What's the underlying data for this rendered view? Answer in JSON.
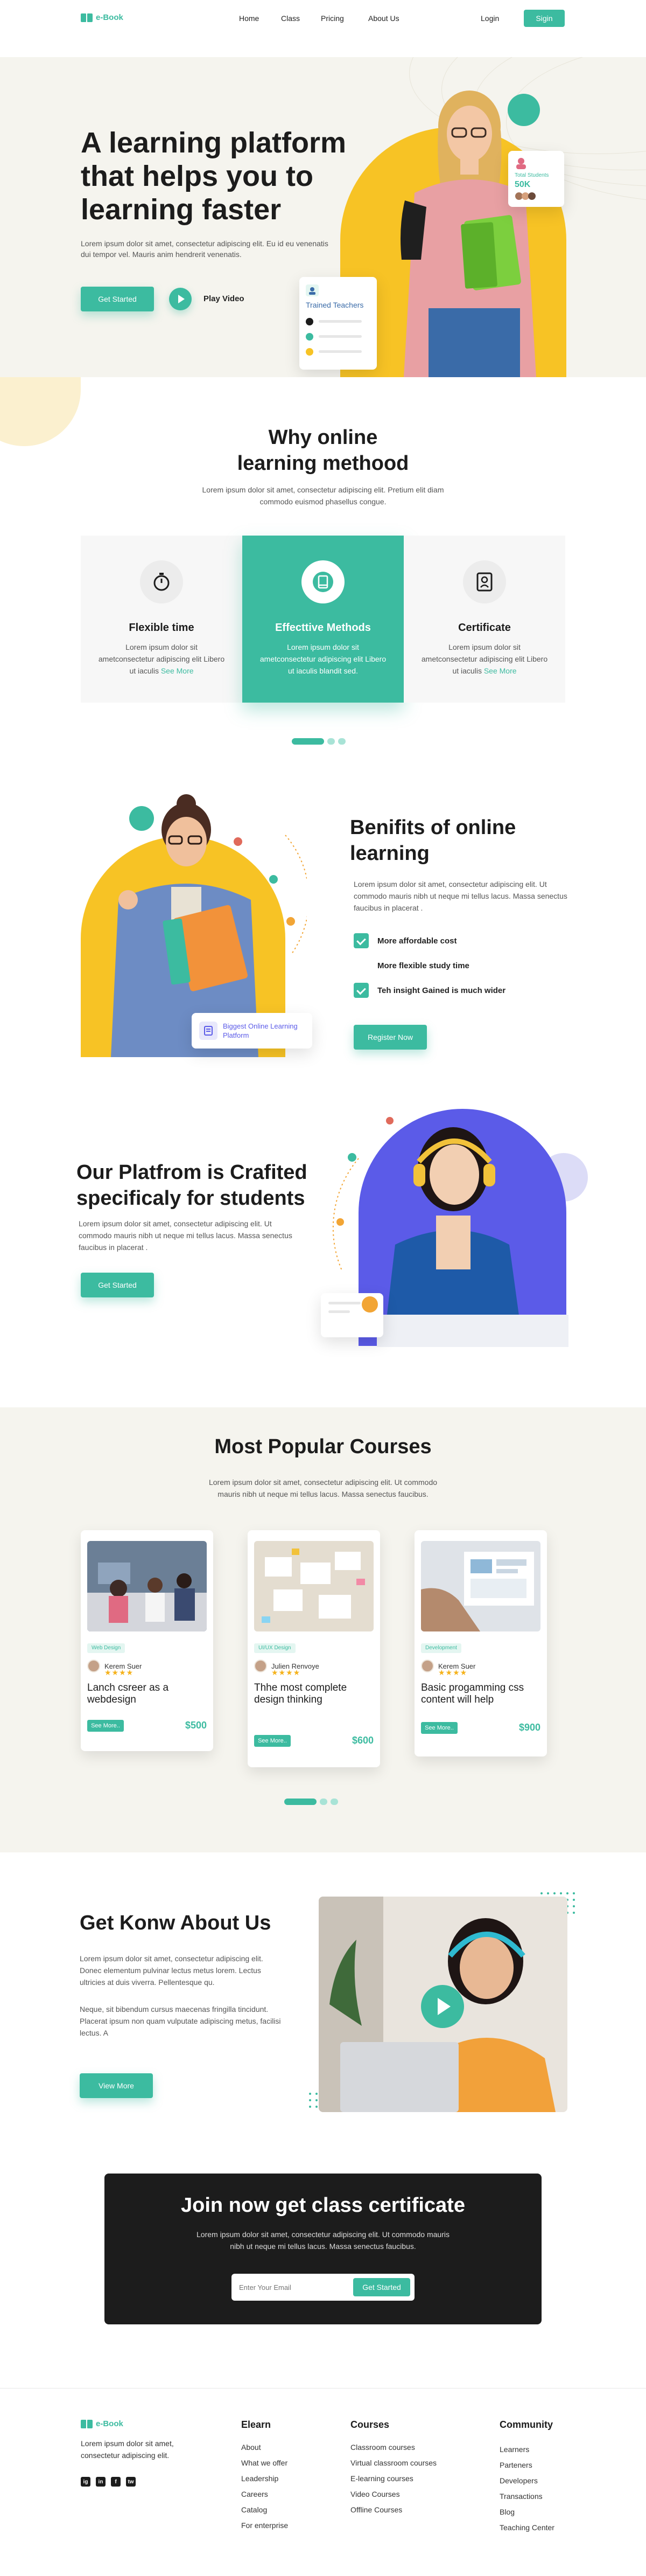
{
  "nav": {
    "brand": "e-Book",
    "links": [
      "Home",
      "Class",
      "Pricing",
      "About Us"
    ],
    "login": "Login",
    "signin": "Sigin"
  },
  "hero": {
    "title": "A learning platform that helps you to learning faster",
    "text": "Lorem ipsum dolor sit amet, consectetur adipiscing elit. Eu id eu venenatis dui tempor vel. Mauris anim hendrerit venenatis.",
    "cta": "Get Started",
    "play": "Play Video",
    "stat_label": "Total Students",
    "stat_value": "50K",
    "trained_label": "Trained Teachers"
  },
  "why": {
    "title": "Why online learning methood",
    "text": "Lorem ipsum dolor sit amet, consectetur adipiscing elit. Pretium elit diam commodo euismod phasellus congue.",
    "features": [
      {
        "title": "Flexible time",
        "text": "Lorem ipsum dolor sit ametconsectetur adipiscing elit Libero ut iaculis",
        "link": "See More"
      },
      {
        "title": "Effecttive Methods",
        "text": "Lorem ipsum dolor sit ametconsectetur adipiscing elit Libero ut iaculis blandit sed."
      },
      {
        "title": "Certificate",
        "text": "Lorem ipsum dolor sit ametconsectetur adipiscing elit Libero ut iaculis",
        "link": "See More"
      }
    ]
  },
  "benefits": {
    "title": "Benifits of online learning",
    "text": "Lorem ipsum dolor sit amet, consectetur adipiscing elit. Ut commodo mauris nibh ut neque mi tellus lacus. Massa senectus faucibus in placerat .",
    "items": [
      "More affordable cost",
      "More flexible study time",
      "Teh insight Gained is much wider"
    ],
    "cta": "Register Now",
    "badge": "Biggest Online Learning Platform"
  },
  "crafted": {
    "title": "Our Platfrom is Crafited specificaly for students",
    "text": "Lorem ipsum dolor sit amet, consectetur adipiscing elit. Ut commodo mauris nibh ut neque mi tellus lacus. Massa senectus faucibus in placerat .",
    "cta": "Get Started"
  },
  "courses": {
    "title": "Most Popular Courses",
    "text": "Lorem ipsum dolor sit amet, consectetur adipiscing elit. Ut commodo mauris nibh ut neque mi tellus lacus. Massa senectus faucibus.",
    "items": [
      {
        "tag": "Web Design",
        "author": "Kerem Suer",
        "stars": "★★★★",
        "title": "Lanch csreer as a webdesign",
        "link": "See More..",
        "price": "$500"
      },
      {
        "tag": "UI/UX Design",
        "author": "Julien Renvoye",
        "stars": "★★★★",
        "title": "Thhe most complete design thinking",
        "link": "See More..",
        "price": "$600"
      },
      {
        "tag": "Development",
        "author": "Kerem Suer",
        "stars": "★★★★",
        "title": "Basic progamming css content will help",
        "link": "See More..",
        "price": "$900"
      }
    ]
  },
  "about": {
    "title": "Get Konw About Us",
    "p1": "Lorem ipsum dolor sit amet, consectetur adipiscing elit. Donec elementum pulvinar lectus metus lorem. Lectus ultricies at duis viverra. Pellentesque qu.",
    "p2": "Neque, sit bibendum cursus maecenas fringilla tincidunt. Placerat ipsum non quam vulputate adipiscing metus, facilisi lectus. A",
    "cta": "View More"
  },
  "cta": {
    "title": "Join now get class certificate",
    "text": "Lorem ipsum dolor sit amet, consectetur adipiscing elit. Ut commodo mauris nibh ut neque mi tellus lacus. Massa senectus faucibus.",
    "placeholder": "Enter Your Email",
    "button": "Get Started"
  },
  "footer": {
    "brand": "e-Book",
    "text": "Lorem ipsum dolor sit amet, consectetur adipiscing elit.",
    "social": [
      "ig",
      "in",
      "f",
      "tw"
    ],
    "elearn": {
      "title": "Elearn",
      "items": [
        "About",
        "What we offer",
        "Leadership",
        "Careers",
        "Catalog",
        "For enterprise"
      ]
    },
    "courses": {
      "title": "Courses",
      "items": [
        "Classroom courses",
        "Virtual classroom courses",
        "E-learning courses",
        "Video Courses",
        "Offline Courses"
      ]
    },
    "community": {
      "title": "Community",
      "items": [
        "Learners",
        "Parteners",
        "Developers",
        "Transactions",
        "Blog",
        "Teaching Center"
      ]
    }
  },
  "colors": {
    "accent": "#3cbba0",
    "yellow": "#f7c325",
    "purple": "#5b5be8",
    "dark": "#1c1c1c"
  }
}
